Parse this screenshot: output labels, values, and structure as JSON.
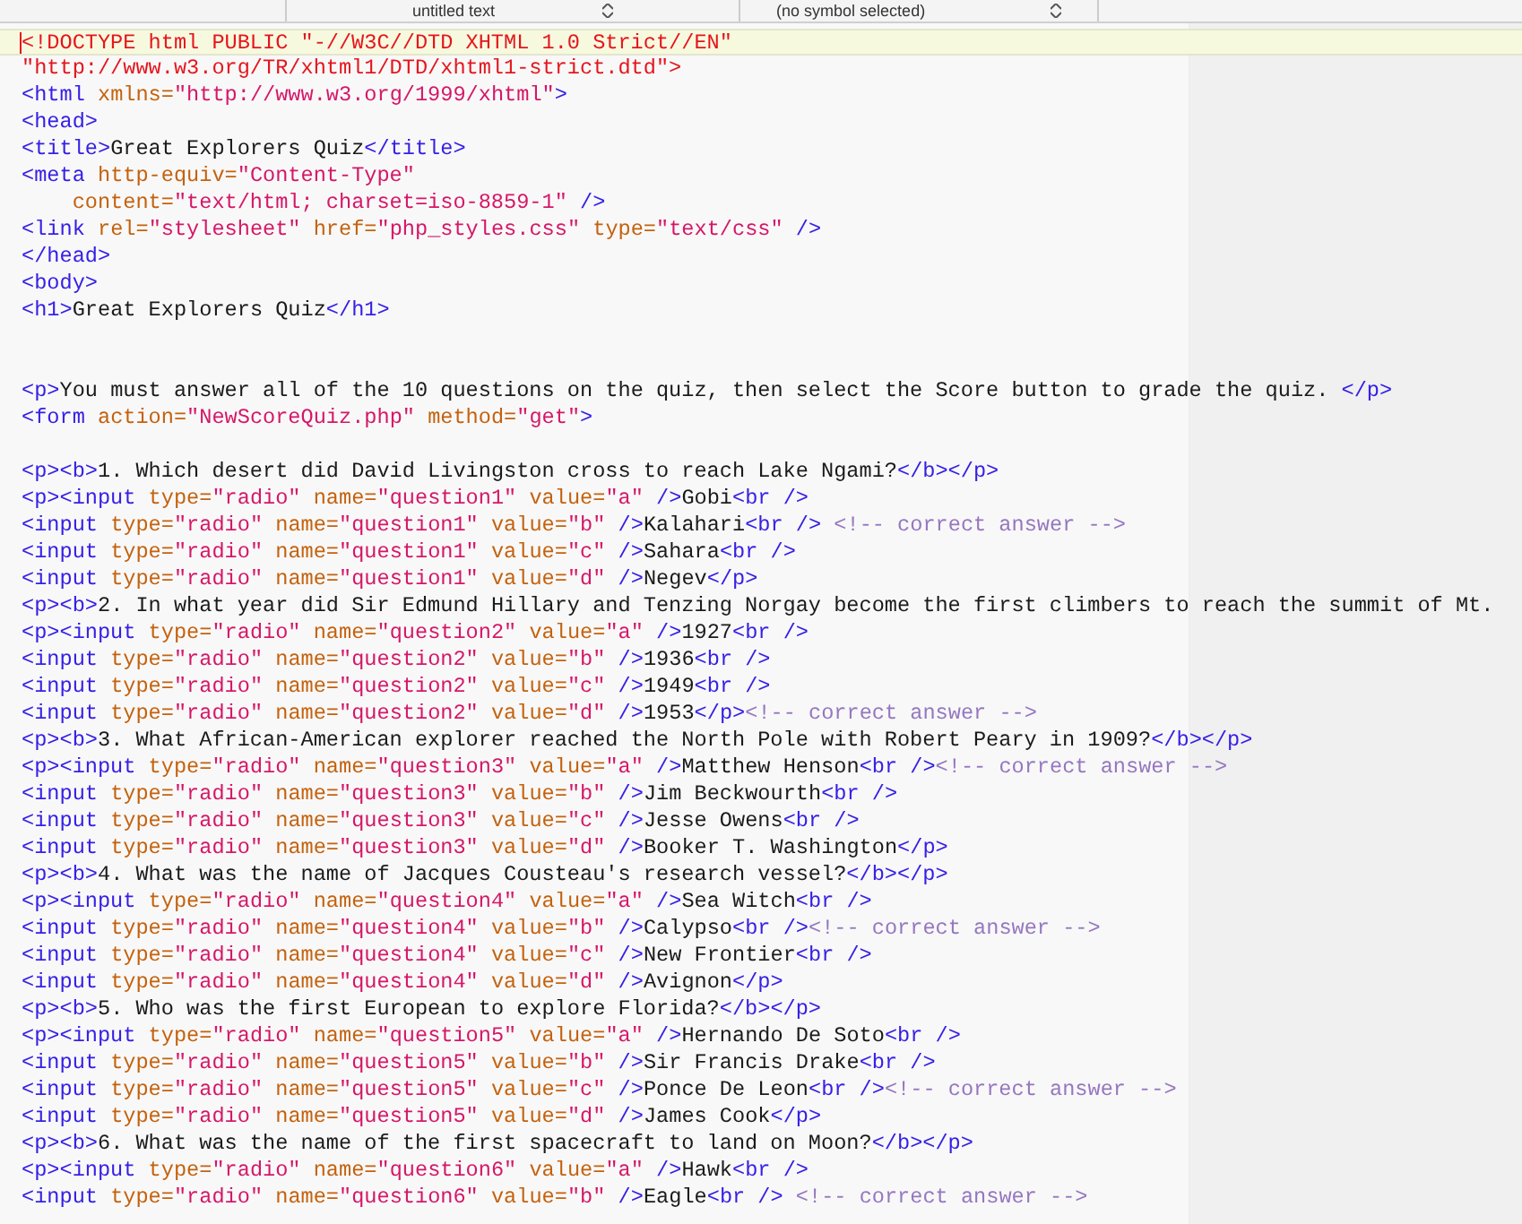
{
  "toolbar": {
    "document_menu": "untitled text",
    "symbol_menu": "(no symbol selected)"
  },
  "editor": {
    "lines": [
      {
        "current": true,
        "tokens": [
          {
            "kind": "doctype",
            "text": "<!DOCTYPE html PUBLIC \"-//W3C//DTD XHTML 1.0 Strict//EN\""
          }
        ]
      },
      {
        "current": false,
        "tokens": [
          {
            "kind": "doctype",
            "text": "\"http://www.w3.org/TR/xhtml1/DTD/xhtml1-strict.dtd\">"
          }
        ]
      },
      {
        "current": false,
        "tokens": [
          {
            "kind": "tag",
            "text": "<html "
          },
          {
            "kind": "attr",
            "text": "xmlns="
          },
          {
            "kind": "string",
            "text": "\"http://www.w3.org/1999/xhtml\""
          },
          {
            "kind": "tag",
            "text": ">"
          }
        ]
      },
      {
        "current": false,
        "tokens": [
          {
            "kind": "tag",
            "text": "<head>"
          }
        ]
      },
      {
        "current": false,
        "tokens": [
          {
            "kind": "tag",
            "text": "<title>"
          },
          {
            "kind": "text",
            "text": "Great Explorers Quiz"
          },
          {
            "kind": "tag",
            "text": "</title>"
          }
        ]
      },
      {
        "current": false,
        "tokens": [
          {
            "kind": "tag",
            "text": "<meta "
          },
          {
            "kind": "attr",
            "text": "http-equiv="
          },
          {
            "kind": "string",
            "text": "\"Content-Type\""
          }
        ]
      },
      {
        "current": false,
        "tokens": [
          {
            "kind": "attr",
            "text": "    content="
          },
          {
            "kind": "string",
            "text": "\"text/html; charset=iso-8859-1\" "
          },
          {
            "kind": "tag",
            "text": "/>"
          }
        ]
      },
      {
        "current": false,
        "tokens": [
          {
            "kind": "tag",
            "text": "<link "
          },
          {
            "kind": "attr",
            "text": "rel="
          },
          {
            "kind": "string",
            "text": "\"stylesheet\" "
          },
          {
            "kind": "attr",
            "text": "href="
          },
          {
            "kind": "string",
            "text": "\"php_styles.css\" "
          },
          {
            "kind": "attr",
            "text": "type="
          },
          {
            "kind": "string",
            "text": "\"text/css\" "
          },
          {
            "kind": "tag",
            "text": "/>"
          }
        ]
      },
      {
        "current": false,
        "tokens": [
          {
            "kind": "tag",
            "text": "</head>"
          }
        ]
      },
      {
        "current": false,
        "tokens": [
          {
            "kind": "tag",
            "text": "<body>"
          }
        ]
      },
      {
        "current": false,
        "tokens": [
          {
            "kind": "tag",
            "text": "<h1>"
          },
          {
            "kind": "text",
            "text": "Great Explorers Quiz"
          },
          {
            "kind": "tag",
            "text": "</h1>"
          }
        ]
      },
      {
        "current": false
      },
      {
        "current": false
      },
      {
        "current": false,
        "tokens": [
          {
            "kind": "tag",
            "text": "<p>"
          },
          {
            "kind": "text",
            "text": "You must answer all of the 10 questions on the quiz, then select the Score button to grade the quiz. "
          },
          {
            "kind": "tag",
            "text": "</p>"
          }
        ]
      },
      {
        "current": false,
        "tokens": [
          {
            "kind": "tag",
            "text": "<form "
          },
          {
            "kind": "attr",
            "text": "action="
          },
          {
            "kind": "string",
            "text": "\"NewScoreQuiz.php\" "
          },
          {
            "kind": "attr",
            "text": "method="
          },
          {
            "kind": "string",
            "text": "\"get\""
          },
          {
            "kind": "tag",
            "text": ">"
          }
        ]
      },
      {
        "current": false
      },
      {
        "current": false,
        "tokens": [
          {
            "kind": "tag",
            "text": "<p><b>"
          },
          {
            "kind": "text",
            "text": "1. Which desert did David Livingston cross to reach Lake Ngami?"
          },
          {
            "kind": "tag",
            "text": "</b></p>"
          }
        ]
      },
      {
        "current": false,
        "tokens": [
          {
            "kind": "tag",
            "text": "<p><input "
          },
          {
            "kind": "attr",
            "text": "type="
          },
          {
            "kind": "string",
            "text": "\"radio\" "
          },
          {
            "kind": "attr",
            "text": "name="
          },
          {
            "kind": "string",
            "text": "\"question1\" "
          },
          {
            "kind": "attr",
            "text": "value="
          },
          {
            "kind": "string",
            "text": "\"a\" "
          },
          {
            "kind": "tag",
            "text": "/>"
          },
          {
            "kind": "text",
            "text": "Gobi"
          },
          {
            "kind": "tag",
            "text": "<br />"
          }
        ]
      },
      {
        "current": false,
        "tokens": [
          {
            "kind": "tag",
            "text": "<input "
          },
          {
            "kind": "attr",
            "text": "type="
          },
          {
            "kind": "string",
            "text": "\"radio\" "
          },
          {
            "kind": "attr",
            "text": "name="
          },
          {
            "kind": "string",
            "text": "\"question1\" "
          },
          {
            "kind": "attr",
            "text": "value="
          },
          {
            "kind": "string",
            "text": "\"b\" "
          },
          {
            "kind": "tag",
            "text": "/>"
          },
          {
            "kind": "text",
            "text": "Kalahari"
          },
          {
            "kind": "tag",
            "text": "<br /> "
          },
          {
            "kind": "comment",
            "text": "<!-- correct answer -->"
          }
        ]
      },
      {
        "current": false,
        "tokens": [
          {
            "kind": "tag",
            "text": "<input "
          },
          {
            "kind": "attr",
            "text": "type="
          },
          {
            "kind": "string",
            "text": "\"radio\" "
          },
          {
            "kind": "attr",
            "text": "name="
          },
          {
            "kind": "string",
            "text": "\"question1\" "
          },
          {
            "kind": "attr",
            "text": "value="
          },
          {
            "kind": "string",
            "text": "\"c\" "
          },
          {
            "kind": "tag",
            "text": "/>"
          },
          {
            "kind": "text",
            "text": "Sahara"
          },
          {
            "kind": "tag",
            "text": "<br />"
          }
        ]
      },
      {
        "current": false,
        "tokens": [
          {
            "kind": "tag",
            "text": "<input "
          },
          {
            "kind": "attr",
            "text": "type="
          },
          {
            "kind": "string",
            "text": "\"radio\" "
          },
          {
            "kind": "attr",
            "text": "name="
          },
          {
            "kind": "string",
            "text": "\"question1\" "
          },
          {
            "kind": "attr",
            "text": "value="
          },
          {
            "kind": "string",
            "text": "\"d\" "
          },
          {
            "kind": "tag",
            "text": "/>"
          },
          {
            "kind": "text",
            "text": "Negev"
          },
          {
            "kind": "tag",
            "text": "</p>"
          }
        ]
      },
      {
        "current": false,
        "tokens": [
          {
            "kind": "tag",
            "text": "<p><b>"
          },
          {
            "kind": "text",
            "text": "2. In what year did Sir Edmund Hillary and Tenzing Norgay become the first climbers to reach the summit of Mt."
          }
        ]
      },
      {
        "current": false,
        "tokens": [
          {
            "kind": "tag",
            "text": "<p><input "
          },
          {
            "kind": "attr",
            "text": "type="
          },
          {
            "kind": "string",
            "text": "\"radio\" "
          },
          {
            "kind": "attr",
            "text": "name="
          },
          {
            "kind": "string",
            "text": "\"question2\" "
          },
          {
            "kind": "attr",
            "text": "value="
          },
          {
            "kind": "string",
            "text": "\"a\" "
          },
          {
            "kind": "tag",
            "text": "/>"
          },
          {
            "kind": "text",
            "text": "1927"
          },
          {
            "kind": "tag",
            "text": "<br />"
          }
        ]
      },
      {
        "current": false,
        "tokens": [
          {
            "kind": "tag",
            "text": "<input "
          },
          {
            "kind": "attr",
            "text": "type="
          },
          {
            "kind": "string",
            "text": "\"radio\" "
          },
          {
            "kind": "attr",
            "text": "name="
          },
          {
            "kind": "string",
            "text": "\"question2\" "
          },
          {
            "kind": "attr",
            "text": "value="
          },
          {
            "kind": "string",
            "text": "\"b\" "
          },
          {
            "kind": "tag",
            "text": "/>"
          },
          {
            "kind": "text",
            "text": "1936"
          },
          {
            "kind": "tag",
            "text": "<br />"
          }
        ]
      },
      {
        "current": false,
        "tokens": [
          {
            "kind": "tag",
            "text": "<input "
          },
          {
            "kind": "attr",
            "text": "type="
          },
          {
            "kind": "string",
            "text": "\"radio\" "
          },
          {
            "kind": "attr",
            "text": "name="
          },
          {
            "kind": "string",
            "text": "\"question2\" "
          },
          {
            "kind": "attr",
            "text": "value="
          },
          {
            "kind": "string",
            "text": "\"c\" "
          },
          {
            "kind": "tag",
            "text": "/>"
          },
          {
            "kind": "text",
            "text": "1949"
          },
          {
            "kind": "tag",
            "text": "<br />"
          }
        ]
      },
      {
        "current": false,
        "tokens": [
          {
            "kind": "tag",
            "text": "<input "
          },
          {
            "kind": "attr",
            "text": "type="
          },
          {
            "kind": "string",
            "text": "\"radio\" "
          },
          {
            "kind": "attr",
            "text": "name="
          },
          {
            "kind": "string",
            "text": "\"question2\" "
          },
          {
            "kind": "attr",
            "text": "value="
          },
          {
            "kind": "string",
            "text": "\"d\" "
          },
          {
            "kind": "tag",
            "text": "/>"
          },
          {
            "kind": "text",
            "text": "1953"
          },
          {
            "kind": "tag",
            "text": "</p>"
          },
          {
            "kind": "comment",
            "text": "<!-- correct answer -->"
          }
        ]
      },
      {
        "current": false,
        "tokens": [
          {
            "kind": "tag",
            "text": "<p><b>"
          },
          {
            "kind": "text",
            "text": "3. What African-American explorer reached the North Pole with Robert Peary in 1909?"
          },
          {
            "kind": "tag",
            "text": "</b></p>"
          }
        ]
      },
      {
        "current": false,
        "tokens": [
          {
            "kind": "tag",
            "text": "<p><input "
          },
          {
            "kind": "attr",
            "text": "type="
          },
          {
            "kind": "string",
            "text": "\"radio\" "
          },
          {
            "kind": "attr",
            "text": "name="
          },
          {
            "kind": "string",
            "text": "\"question3\" "
          },
          {
            "kind": "attr",
            "text": "value="
          },
          {
            "kind": "string",
            "text": "\"a\" "
          },
          {
            "kind": "tag",
            "text": "/>"
          },
          {
            "kind": "text",
            "text": "Matthew Henson"
          },
          {
            "kind": "tag",
            "text": "<br />"
          },
          {
            "kind": "comment",
            "text": "<!-- correct answer -->"
          }
        ]
      },
      {
        "current": false,
        "tokens": [
          {
            "kind": "tag",
            "text": "<input "
          },
          {
            "kind": "attr",
            "text": "type="
          },
          {
            "kind": "string",
            "text": "\"radio\" "
          },
          {
            "kind": "attr",
            "text": "name="
          },
          {
            "kind": "string",
            "text": "\"question3\" "
          },
          {
            "kind": "attr",
            "text": "value="
          },
          {
            "kind": "string",
            "text": "\"b\" "
          },
          {
            "kind": "tag",
            "text": "/>"
          },
          {
            "kind": "text",
            "text": "Jim Beckwourth"
          },
          {
            "kind": "tag",
            "text": "<br />"
          }
        ]
      },
      {
        "current": false,
        "tokens": [
          {
            "kind": "tag",
            "text": "<input "
          },
          {
            "kind": "attr",
            "text": "type="
          },
          {
            "kind": "string",
            "text": "\"radio\" "
          },
          {
            "kind": "attr",
            "text": "name="
          },
          {
            "kind": "string",
            "text": "\"question3\" "
          },
          {
            "kind": "attr",
            "text": "value="
          },
          {
            "kind": "string",
            "text": "\"c\" "
          },
          {
            "kind": "tag",
            "text": "/>"
          },
          {
            "kind": "text",
            "text": "Jesse Owens"
          },
          {
            "kind": "tag",
            "text": "<br />"
          }
        ]
      },
      {
        "current": false,
        "tokens": [
          {
            "kind": "tag",
            "text": "<input "
          },
          {
            "kind": "attr",
            "text": "type="
          },
          {
            "kind": "string",
            "text": "\"radio\" "
          },
          {
            "kind": "attr",
            "text": "name="
          },
          {
            "kind": "string",
            "text": "\"question3\" "
          },
          {
            "kind": "attr",
            "text": "value="
          },
          {
            "kind": "string",
            "text": "\"d\" "
          },
          {
            "kind": "tag",
            "text": "/>"
          },
          {
            "kind": "text",
            "text": "Booker T. Washington"
          },
          {
            "kind": "tag",
            "text": "</p>"
          }
        ]
      },
      {
        "current": false,
        "tokens": [
          {
            "kind": "tag",
            "text": "<p><b>"
          },
          {
            "kind": "text",
            "text": "4. What was the name of Jacques Cousteau's research vessel?"
          },
          {
            "kind": "tag",
            "text": "</b></p>"
          }
        ]
      },
      {
        "current": false,
        "tokens": [
          {
            "kind": "tag",
            "text": "<p><input "
          },
          {
            "kind": "attr",
            "text": "type="
          },
          {
            "kind": "string",
            "text": "\"radio\" "
          },
          {
            "kind": "attr",
            "text": "name="
          },
          {
            "kind": "string",
            "text": "\"question4\" "
          },
          {
            "kind": "attr",
            "text": "value="
          },
          {
            "kind": "string",
            "text": "\"a\" "
          },
          {
            "kind": "tag",
            "text": "/>"
          },
          {
            "kind": "text",
            "text": "Sea Witch"
          },
          {
            "kind": "tag",
            "text": "<br />"
          }
        ]
      },
      {
        "current": false,
        "tokens": [
          {
            "kind": "tag",
            "text": "<input "
          },
          {
            "kind": "attr",
            "text": "type="
          },
          {
            "kind": "string",
            "text": "\"radio\" "
          },
          {
            "kind": "attr",
            "text": "name="
          },
          {
            "kind": "string",
            "text": "\"question4\" "
          },
          {
            "kind": "attr",
            "text": "value="
          },
          {
            "kind": "string",
            "text": "\"b\" "
          },
          {
            "kind": "tag",
            "text": "/>"
          },
          {
            "kind": "text",
            "text": "Calypso"
          },
          {
            "kind": "tag",
            "text": "<br />"
          },
          {
            "kind": "comment",
            "text": "<!-- correct answer -->"
          }
        ]
      },
      {
        "current": false,
        "tokens": [
          {
            "kind": "tag",
            "text": "<input "
          },
          {
            "kind": "attr",
            "text": "type="
          },
          {
            "kind": "string",
            "text": "\"radio\" "
          },
          {
            "kind": "attr",
            "text": "name="
          },
          {
            "kind": "string",
            "text": "\"question4\" "
          },
          {
            "kind": "attr",
            "text": "value="
          },
          {
            "kind": "string",
            "text": "\"c\" "
          },
          {
            "kind": "tag",
            "text": "/>"
          },
          {
            "kind": "text",
            "text": "New Frontier"
          },
          {
            "kind": "tag",
            "text": "<br />"
          }
        ]
      },
      {
        "current": false,
        "tokens": [
          {
            "kind": "tag",
            "text": "<input "
          },
          {
            "kind": "attr",
            "text": "type="
          },
          {
            "kind": "string",
            "text": "\"radio\" "
          },
          {
            "kind": "attr",
            "text": "name="
          },
          {
            "kind": "string",
            "text": "\"question4\" "
          },
          {
            "kind": "attr",
            "text": "value="
          },
          {
            "kind": "string",
            "text": "\"d\" "
          },
          {
            "kind": "tag",
            "text": "/>"
          },
          {
            "kind": "text",
            "text": "Avignon"
          },
          {
            "kind": "tag",
            "text": "</p>"
          }
        ]
      },
      {
        "current": false,
        "tokens": [
          {
            "kind": "tag",
            "text": "<p><b>"
          },
          {
            "kind": "text",
            "text": "5. Who was the first European to explore Florida?"
          },
          {
            "kind": "tag",
            "text": "</b></p>"
          }
        ]
      },
      {
        "current": false,
        "tokens": [
          {
            "kind": "tag",
            "text": "<p><input "
          },
          {
            "kind": "attr",
            "text": "type="
          },
          {
            "kind": "string",
            "text": "\"radio\" "
          },
          {
            "kind": "attr",
            "text": "name="
          },
          {
            "kind": "string",
            "text": "\"question5\" "
          },
          {
            "kind": "attr",
            "text": "value="
          },
          {
            "kind": "string",
            "text": "\"a\" "
          },
          {
            "kind": "tag",
            "text": "/>"
          },
          {
            "kind": "text",
            "text": "Hernando De Soto"
          },
          {
            "kind": "tag",
            "text": "<br />"
          }
        ]
      },
      {
        "current": false,
        "tokens": [
          {
            "kind": "tag",
            "text": "<input "
          },
          {
            "kind": "attr",
            "text": "type="
          },
          {
            "kind": "string",
            "text": "\"radio\" "
          },
          {
            "kind": "attr",
            "text": "name="
          },
          {
            "kind": "string",
            "text": "\"question5\" "
          },
          {
            "kind": "attr",
            "text": "value="
          },
          {
            "kind": "string",
            "text": "\"b\" "
          },
          {
            "kind": "tag",
            "text": "/>"
          },
          {
            "kind": "text",
            "text": "Sir Francis Drake"
          },
          {
            "kind": "tag",
            "text": "<br />"
          }
        ]
      },
      {
        "current": false,
        "tokens": [
          {
            "kind": "tag",
            "text": "<input "
          },
          {
            "kind": "attr",
            "text": "type="
          },
          {
            "kind": "string",
            "text": "\"radio\" "
          },
          {
            "kind": "attr",
            "text": "name="
          },
          {
            "kind": "string",
            "text": "\"question5\" "
          },
          {
            "kind": "attr",
            "text": "value="
          },
          {
            "kind": "string",
            "text": "\"c\" "
          },
          {
            "kind": "tag",
            "text": "/>"
          },
          {
            "kind": "text",
            "text": "Ponce De Leon"
          },
          {
            "kind": "tag",
            "text": "<br />"
          },
          {
            "kind": "comment",
            "text": "<!-- correct answer -->"
          }
        ]
      },
      {
        "current": false,
        "tokens": [
          {
            "kind": "tag",
            "text": "<input "
          },
          {
            "kind": "attr",
            "text": "type="
          },
          {
            "kind": "string",
            "text": "\"radio\" "
          },
          {
            "kind": "attr",
            "text": "name="
          },
          {
            "kind": "string",
            "text": "\"question5\" "
          },
          {
            "kind": "attr",
            "text": "value="
          },
          {
            "kind": "string",
            "text": "\"d\" "
          },
          {
            "kind": "tag",
            "text": "/>"
          },
          {
            "kind": "text",
            "text": "James Cook"
          },
          {
            "kind": "tag",
            "text": "</p>"
          }
        ]
      },
      {
        "current": false,
        "tokens": [
          {
            "kind": "tag",
            "text": "<p><b>"
          },
          {
            "kind": "text",
            "text": "6. What was the name of the first spacecraft to land on Moon?"
          },
          {
            "kind": "tag",
            "text": "</b></p>"
          }
        ]
      },
      {
        "current": false,
        "tokens": [
          {
            "kind": "tag",
            "text": "<p><input "
          },
          {
            "kind": "attr",
            "text": "type="
          },
          {
            "kind": "string",
            "text": "\"radio\" "
          },
          {
            "kind": "attr",
            "text": "name="
          },
          {
            "kind": "string",
            "text": "\"question6\" "
          },
          {
            "kind": "attr",
            "text": "value="
          },
          {
            "kind": "string",
            "text": "\"a\" "
          },
          {
            "kind": "tag",
            "text": "/>"
          },
          {
            "kind": "text",
            "text": "Hawk"
          },
          {
            "kind": "tag",
            "text": "<br />"
          }
        ]
      },
      {
        "current": false,
        "tokens": [
          {
            "kind": "tag",
            "text": "<input "
          },
          {
            "kind": "attr",
            "text": "type="
          },
          {
            "kind": "string",
            "text": "\"radio\" "
          },
          {
            "kind": "attr",
            "text": "name="
          },
          {
            "kind": "string",
            "text": "\"question6\" "
          },
          {
            "kind": "attr",
            "text": "value="
          },
          {
            "kind": "string",
            "text": "\"b\" "
          },
          {
            "kind": "tag",
            "text": "/>"
          },
          {
            "kind": "text",
            "text": "Eagle"
          },
          {
            "kind": "tag",
            "text": "<br /> "
          },
          {
            "kind": "comment",
            "text": "<!-- correct answer -->"
          }
        ]
      }
    ]
  }
}
